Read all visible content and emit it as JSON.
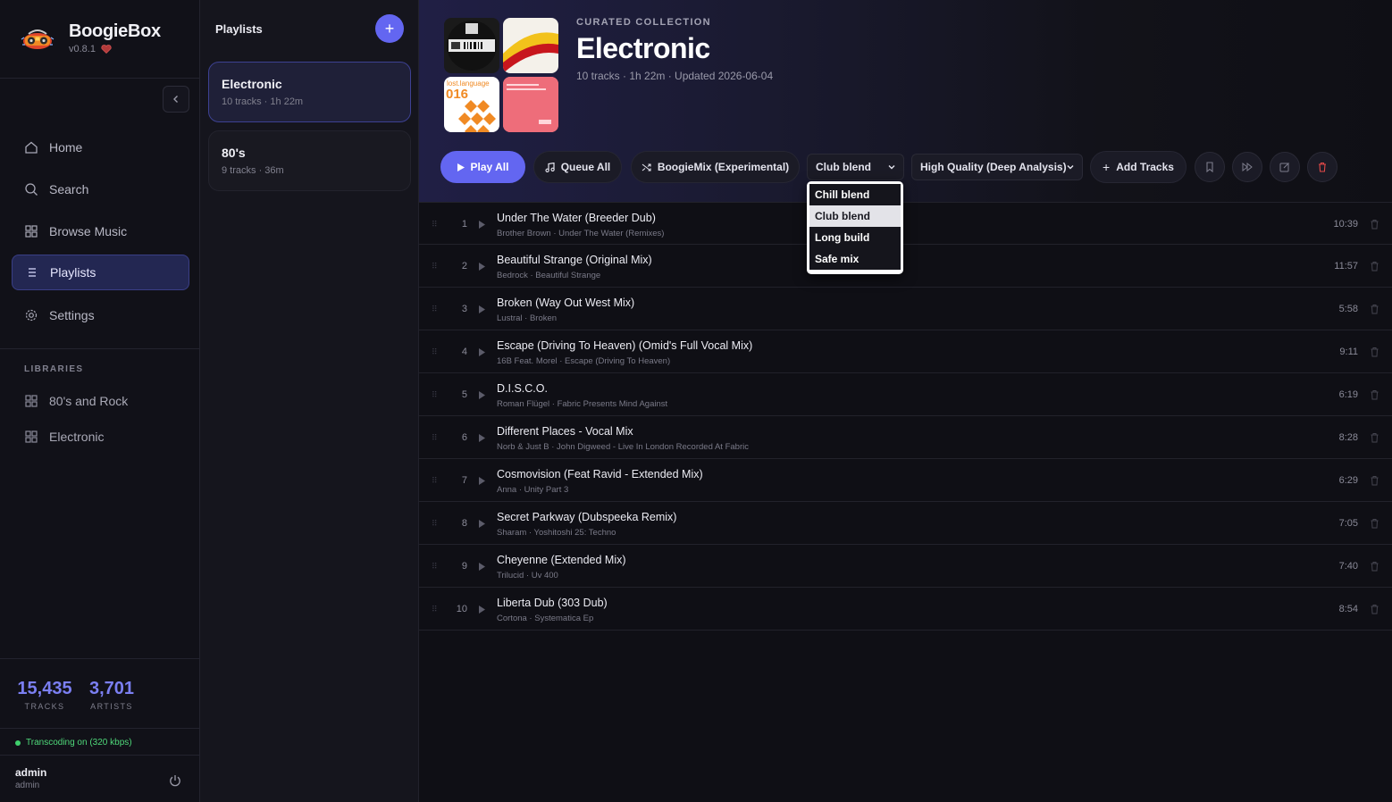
{
  "app": {
    "name": "BoogieBox",
    "version": "v0.8.1"
  },
  "nav": [
    {
      "label": "Home",
      "icon": "home-icon"
    },
    {
      "label": "Search",
      "icon": "search-icon"
    },
    {
      "label": "Browse Music",
      "icon": "grid-icon"
    },
    {
      "label": "Playlists",
      "icon": "list-icon",
      "active": true
    },
    {
      "label": "Settings",
      "icon": "gear-icon"
    }
  ],
  "libraries": {
    "title": "LIBRARIES",
    "items": [
      {
        "label": "80's and Rock"
      },
      {
        "label": "Electronic"
      }
    ]
  },
  "stats": {
    "tracks": {
      "value": "15,435",
      "label": "TRACKS"
    },
    "artists": {
      "value": "3,701",
      "label": "ARTISTS"
    }
  },
  "status": {
    "transcoding": "Transcoding on (320 kbps)"
  },
  "user": {
    "name": "admin",
    "role": "admin"
  },
  "playlists_panel": {
    "title": "Playlists",
    "add_label": "+",
    "items": [
      {
        "name": "Electronic",
        "meta": "10 tracks · 1h 22m",
        "active": true
      },
      {
        "name": "80's",
        "meta": "9 tracks · 36m",
        "active": false
      }
    ]
  },
  "playlist": {
    "eyebrow": "CURATED COLLECTION",
    "title": "Electronic",
    "meta": "10 tracks · 1h 22m · Updated 2026-06-04"
  },
  "toolbar": {
    "play_all": "Play All",
    "queue_all": "Queue All",
    "boogiemix": "BoogieMix (Experimental)",
    "blend_selected": "Club blend",
    "quality_selected": "High Quality (Deep Analysis)",
    "add_tracks": "Add Tracks"
  },
  "blend_options": [
    "Chill blend",
    "Club blend",
    "Long build",
    "Safe mix"
  ],
  "blend_selected_index": 1,
  "tracks": [
    {
      "n": "1",
      "title": "Under The Water (Breeder Dub)",
      "sub": "Brother Brown · Under The Water (Remixes)",
      "dur": "10:39"
    },
    {
      "n": "2",
      "title": "Beautiful Strange (Original Mix)",
      "sub": "Bedrock · Beautiful Strange",
      "dur": "11:57"
    },
    {
      "n": "3",
      "title": "Broken (Way Out West Mix)",
      "sub": "Lustral · Broken",
      "dur": "5:58"
    },
    {
      "n": "4",
      "title": "Escape (Driving To Heaven) (Omid's Full Vocal Mix)",
      "sub": "16B Feat. Morel · Escape (Driving To Heaven)",
      "dur": "9:11"
    },
    {
      "n": "5",
      "title": "D.I.S.C.O.",
      "sub": "Roman Flügel · Fabric Presents Mind Against",
      "dur": "6:19"
    },
    {
      "n": "6",
      "title": "Different Places - Vocal Mix",
      "sub": "Norb & Just B · John Digweed - Live In London Recorded At Fabric",
      "dur": "8:28"
    },
    {
      "n": "7",
      "title": "Cosmovision (Feat Ravid - Extended Mix)",
      "sub": "Anna · Unity Part 3",
      "dur": "6:29"
    },
    {
      "n": "8",
      "title": "Secret Parkway (Dubspeeka Remix)",
      "sub": "Sharam · Yoshitoshi 25: Techno",
      "dur": "7:05"
    },
    {
      "n": "9",
      "title": "Cheyenne (Extended Mix)",
      "sub": "Trilucid · Uv 400",
      "dur": "7:40"
    },
    {
      "n": "10",
      "title": "Liberta Dub (303 Dub)",
      "sub": "Cortona · Systematica Ep",
      "dur": "8:54"
    }
  ],
  "colors": {
    "accent": "#6366f1",
    "stat": "#7b7ff2",
    "status_ok": "#3fd06c",
    "danger": "#e04848"
  }
}
